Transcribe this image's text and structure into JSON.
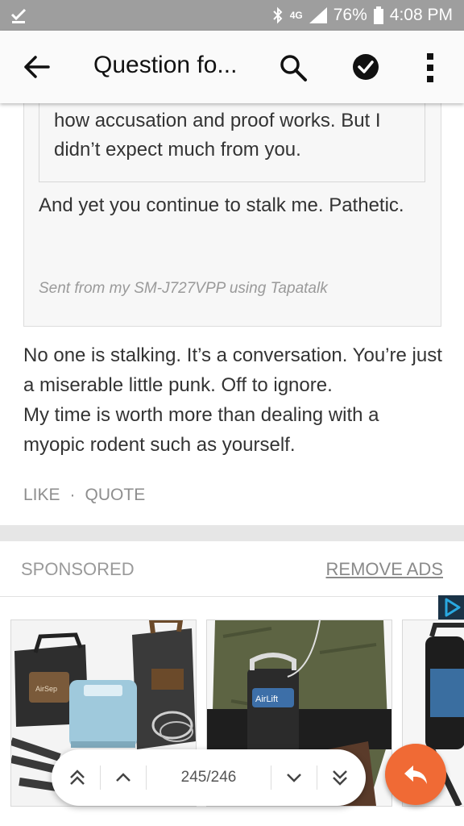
{
  "status_bar": {
    "network": "4G",
    "battery": "76%",
    "time": "4:08 PM"
  },
  "app_bar": {
    "title": "Question fo..."
  },
  "quoted_post": {
    "nested_quote_text": "how accusation and proof works. But I didn’t expect much from you.",
    "reply_text": "And yet you continue to stalk me. Pathetic.",
    "signature": "Sent from my SM-J727VPP using Tapatalk"
  },
  "post": {
    "paragraph_1": "No one is stalking. It’s a conversation. You’re just a miserable little punk. Off to ignore.",
    "paragraph_2": "My time is worth more than dealing with a myopic rodent such as yourself."
  },
  "actions": {
    "like": "LIKE",
    "separator": "·",
    "quote": "QUOTE"
  },
  "sponsored": {
    "label": "SPONSORED",
    "remove_ads": "REMOVE ADS"
  },
  "ads": [
    {
      "logo": "AirSep"
    },
    {
      "logo": "AirLift"
    },
    {
      "logo": ""
    }
  ],
  "pagination": {
    "count": "245/246"
  },
  "colors": {
    "status_bar": "#9e9e9e",
    "app_bar": "#fafafa",
    "fab": "#f06a35",
    "text": "#333333",
    "muted": "#8e8e8e"
  }
}
